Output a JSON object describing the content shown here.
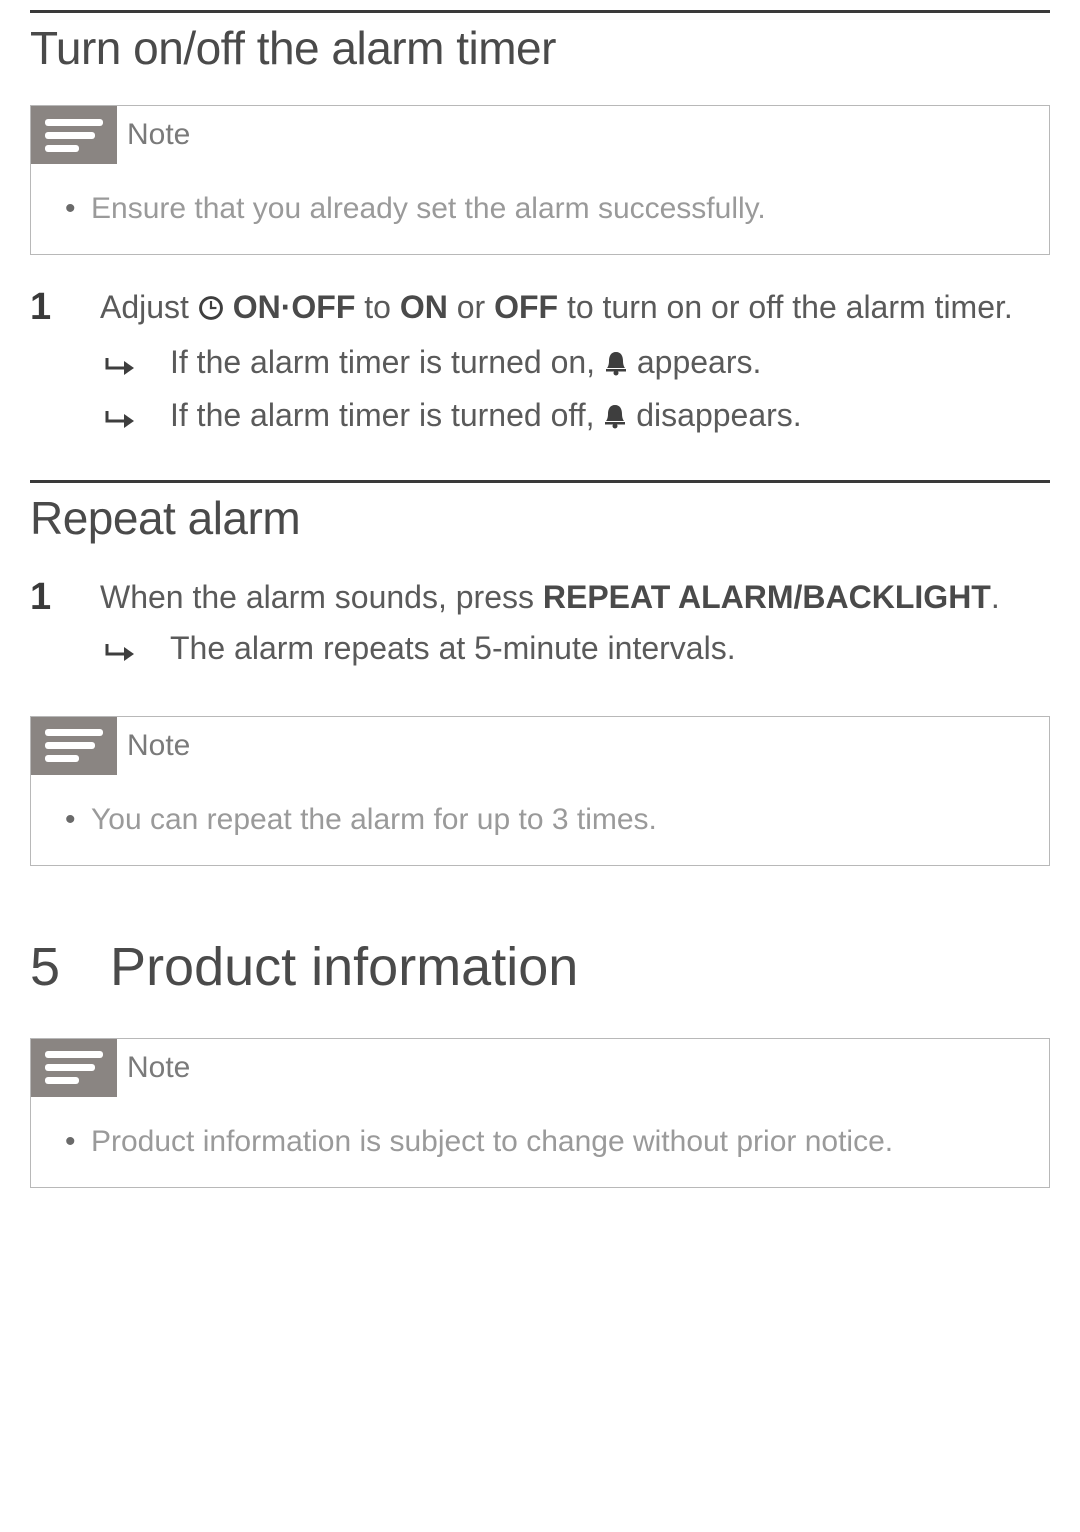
{
  "section1": {
    "heading": "Turn on/off the alarm timer",
    "note_label": "Note",
    "note_item": "Ensure that you already set the alarm successfully.",
    "step1_pre": "Adjust ",
    "step1_onoff": " ON·OFF",
    "step1_mid1": " to ",
    "step1_on": "ON",
    "step1_mid2": " or ",
    "step1_off": "OFF",
    "step1_post": " to turn on or off the alarm timer.",
    "sub1_pre": "If the alarm timer is turned on, ",
    "sub1_post": " appears.",
    "sub2_pre": "If the alarm timer is turned off, ",
    "sub2_post": " disappears."
  },
  "section2": {
    "heading": "Repeat alarm",
    "step1_pre": "When the alarm sounds, press ",
    "step1_bold": "REPEAT ALARM/BACKLIGHT",
    "step1_post": ".",
    "sub1": "The alarm repeats at 5-minute intervals.",
    "note_label": "Note",
    "note_item": "You can repeat the alarm for up to 3 times."
  },
  "chapter5": {
    "num": "5",
    "title": "Product information",
    "note_label": "Note",
    "note_item": "Product information is subject to change without prior notice."
  }
}
